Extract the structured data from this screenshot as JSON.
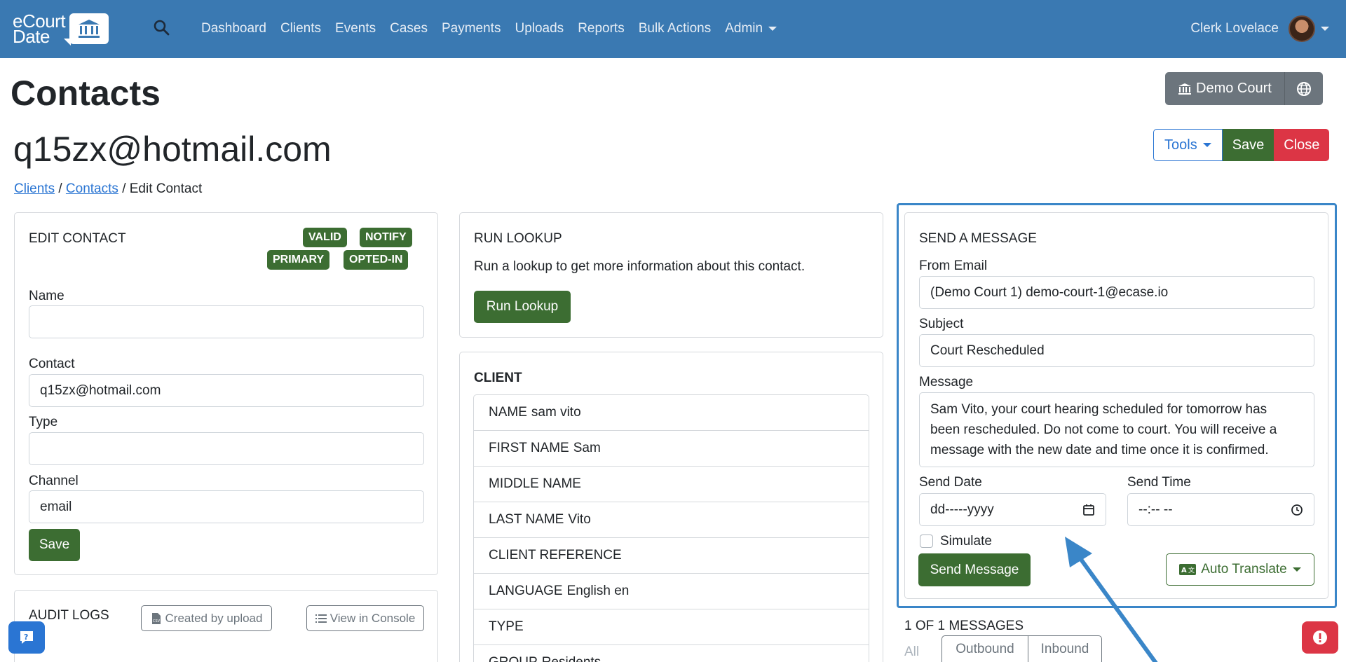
{
  "navbar": {
    "brand_line1": "eCourt",
    "brand_line2": "Date",
    "links": [
      "Dashboard",
      "Clients",
      "Events",
      "Cases",
      "Payments",
      "Uploads",
      "Reports",
      "Bulk Actions",
      "Admin"
    ],
    "user_name": "Clerk Lovelace",
    "brand_color": "#3a79b2"
  },
  "page": {
    "title": "Contacts",
    "court_label": "Demo Court",
    "contact_value": "q15zx@hotmail.com",
    "tools_label": "Tools",
    "save_label": "Save",
    "close_label": "Close"
  },
  "breadcrumb": {
    "clients": "Clients",
    "sep1": "/",
    "contacts": "Contacts",
    "sep2": "/",
    "current": "Edit Contact"
  },
  "edit_contact": {
    "title": "EDIT CONTACT",
    "badges": [
      "VALID",
      "NOTIFY",
      "PRIMARY",
      "OPTED-IN"
    ],
    "name_label": "Name",
    "name_value": "",
    "contact_label": "Contact",
    "contact_value": "q15zx@hotmail.com",
    "type_label": "Type",
    "type_value": "",
    "channel_label": "Channel",
    "channel_value": "email",
    "save_label": "Save"
  },
  "audit_logs": {
    "title": "AUDIT LOGS",
    "created_by_upload": "Created by upload",
    "view_in_console": "View in Console"
  },
  "run_lookup": {
    "title": "RUN LOOKUP",
    "description": "Run a lookup to get more information about this contact.",
    "button_label": "Run Lookup"
  },
  "client": {
    "title": "CLIENT",
    "items": [
      {
        "label": "NAME",
        "value": "sam vito"
      },
      {
        "label": "FIRST NAME",
        "value": "Sam"
      },
      {
        "label": "MIDDLE NAME",
        "value": ""
      },
      {
        "label": "LAST NAME",
        "value": "Vito"
      },
      {
        "label": "CLIENT REFERENCE",
        "value": ""
      },
      {
        "label": "LANGUAGE",
        "value": "English en"
      },
      {
        "label": "TYPE",
        "value": ""
      },
      {
        "label": "GROUP",
        "value": "Residents"
      }
    ]
  },
  "send_message": {
    "title": "SEND A MESSAGE",
    "from_label": "From Email",
    "from_value": "(Demo Court 1) demo-court-1@ecase.io",
    "subject_label": "Subject",
    "subject_value": "Court Rescheduled",
    "message_label": "Message",
    "message_value": "Sam Vito, your court hearing scheduled for tomorrow has been rescheduled. Do not come to court. You will receive a message with the new date and time once it is confirmed.",
    "send_date_label": "Send Date",
    "send_date_placeholder": "dd-----yyyy",
    "send_time_label": "Send Time",
    "send_time_placeholder": "--:-- --",
    "simulate_label": "Simulate",
    "send_button": "Send Message",
    "auto_translate": "Auto Translate"
  },
  "messages": {
    "count_label": "1 OF 1 MESSAGES",
    "tabs": [
      "All",
      "Outbound",
      "Inbound"
    ]
  },
  "colors": {
    "green": "#3c6d32",
    "red": "#dc3545",
    "blue": "#2a75d3",
    "gray": "#6c757d"
  }
}
